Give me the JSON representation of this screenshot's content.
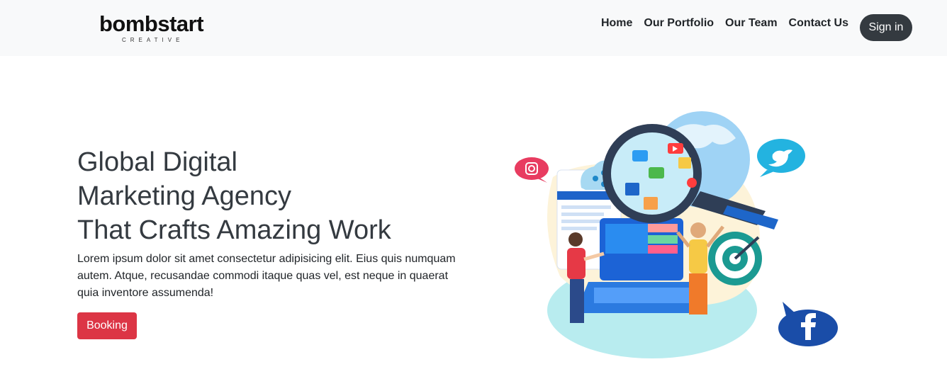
{
  "navbar": {
    "logo": {
      "word": "bombstart",
      "sub": "CREATIVE"
    },
    "links": [
      "Home",
      "Our Portfolio",
      "Our Team",
      "Contact Us"
    ],
    "signin_label": "Sign in"
  },
  "hero": {
    "title_lines": [
      "Global Digital",
      "Marketing Agency",
      "That Crafts Amazing Work"
    ],
    "paragraph": "Lorem ipsum dolor sit amet consectetur adipisicing elit. Eius quis numquam autem. Atque, recusandae commodi itaque quas vel, est neque in quaerat quia inventore assumenda!",
    "button_label": "Booking"
  },
  "colors": {
    "navbar_bg": "#f8f9fa",
    "signin_bg": "#343a40",
    "booking_bg": "#dc3545",
    "heading": "#343a40"
  }
}
